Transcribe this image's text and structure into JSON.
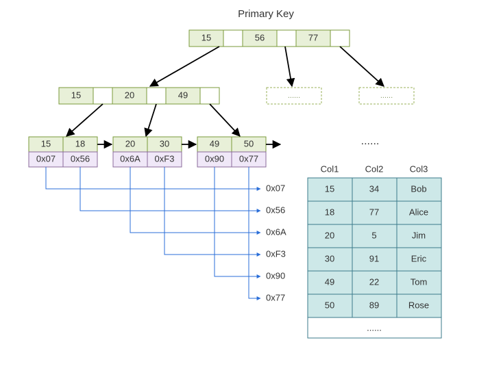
{
  "title": "Primary Key",
  "root_node": {
    "keys": [
      "15",
      "56",
      "77"
    ]
  },
  "internal_node": {
    "keys": [
      "15",
      "20",
      "49"
    ]
  },
  "ghost_nodes": [
    "......",
    "......"
  ],
  "leaf_nodes": [
    {
      "keys": [
        "15",
        "18"
      ],
      "ptrs": [
        "0x07",
        "0x56"
      ]
    },
    {
      "keys": [
        "20",
        "30"
      ],
      "ptrs": [
        "0x6A",
        "0xF3"
      ]
    },
    {
      "keys": [
        "49",
        "50"
      ],
      "ptrs": [
        "0x90",
        "0x77"
      ]
    }
  ],
  "row_labels": [
    "0x07",
    "0x56",
    "0x6A",
    "0xF3",
    "0x90",
    "0x77"
  ],
  "table": {
    "headers": [
      "Col1",
      "Col2",
      "Col3"
    ],
    "rows": [
      [
        "15",
        "34",
        "Bob"
      ],
      [
        "18",
        "77",
        "Alice"
      ],
      [
        "20",
        "5",
        "Jim"
      ],
      [
        "30",
        "91",
        "Eric"
      ],
      [
        "49",
        "22",
        "Tom"
      ],
      [
        "50",
        "89",
        "Rose"
      ]
    ],
    "footer": "......"
  },
  "more_leaves": "......"
}
